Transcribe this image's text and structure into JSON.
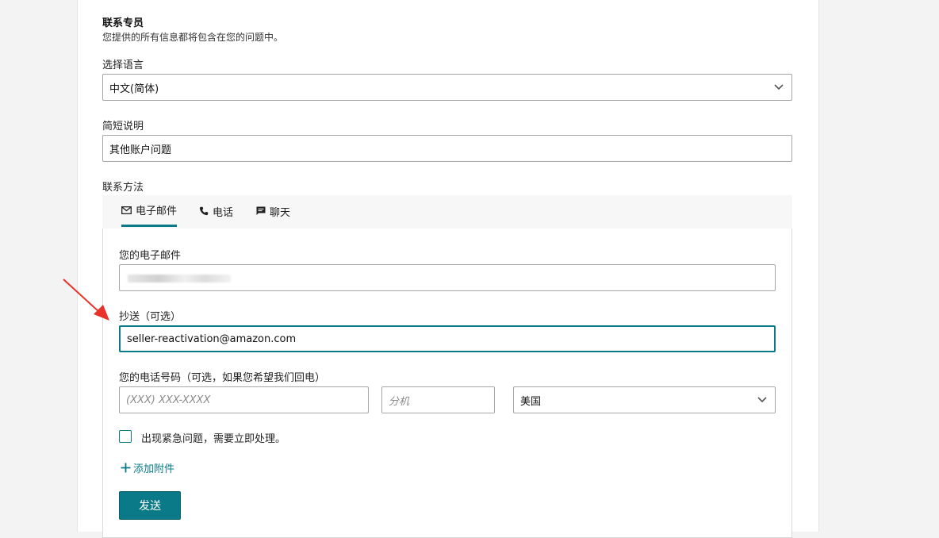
{
  "header": {
    "title": "联系专员",
    "subtitle": "您提供的所有信息都将包含在您的问题中。"
  },
  "language": {
    "label": "选择语言",
    "selected": "中文(简体)"
  },
  "summary": {
    "label": "简短说明",
    "value": "其他账户问题"
  },
  "contact": {
    "label": "联系方法",
    "tabs": [
      {
        "label": "电子邮件",
        "icon": "mail-icon",
        "active": true
      },
      {
        "label": "电话",
        "icon": "phone-icon",
        "active": false
      },
      {
        "label": "聊天",
        "icon": "chat-icon",
        "active": false
      }
    ]
  },
  "form": {
    "email_label": "您的电子邮件",
    "email_value": "",
    "cc_label": "抄送（可选）",
    "cc_value": "seller-reactivation@amazon.com",
    "phone_label": "您的电话号码（可选，如果您希望我们回电）",
    "phone_placeholder": "(XXX) XXX-XXXX",
    "ext_placeholder": "分机",
    "country": "美国",
    "urgent_label": "出现紧急问题，需要立即处理。",
    "attach_label": "添加附件",
    "send_label": "发送"
  },
  "colors": {
    "accent": "#0a7a88",
    "annotation_arrow": "#e8322b"
  }
}
